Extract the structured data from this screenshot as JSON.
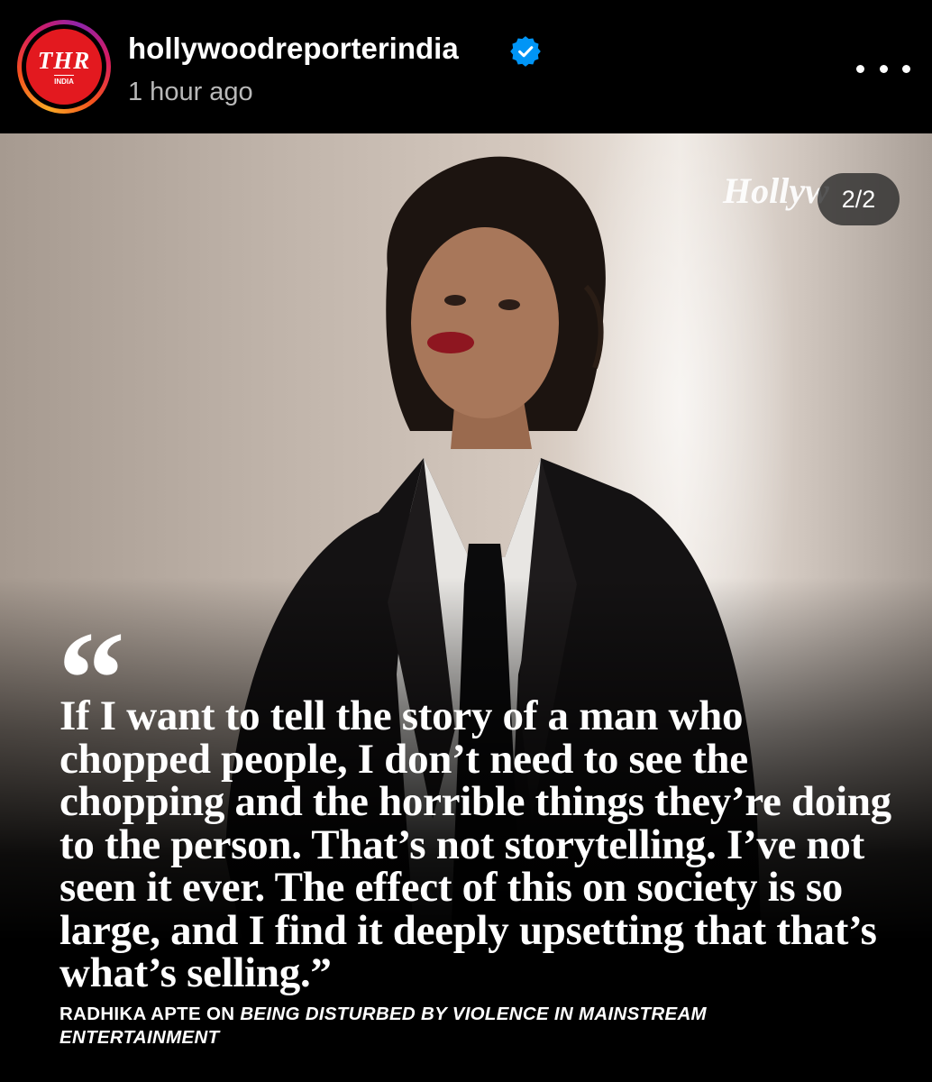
{
  "post_header": {
    "avatar_logo_text": "THR",
    "avatar_logo_subtext": "INDIA",
    "username": "hollywoodreporterindia",
    "timestamp": "1 hour ago",
    "verified": true,
    "more_icon": "more-horizontal-icon"
  },
  "media": {
    "watermark_text": "Hollyw",
    "carousel_counter": "2/2",
    "quote_mark": "“",
    "quote": "If I want to tell the story of a man who chopped people, I don’t need to see the chopping and the horrible things they’re doing to the person. That’s not storytelling. I’ve not seen it ever. The effect of this on society is so large, and I find it deeply upsetting that that’s what’s selling.”",
    "attribution_name": "RADHIKA APTE ON ",
    "attribution_topic": "BEING DISTURBED BY VIOLENCE IN MAINSTREAM ENTERTAINMENT"
  },
  "colors": {
    "background": "#000000",
    "brand_red": "#e3191f",
    "verified_blue": "#0095f6",
    "secondary_text": "#b9b9b9"
  }
}
